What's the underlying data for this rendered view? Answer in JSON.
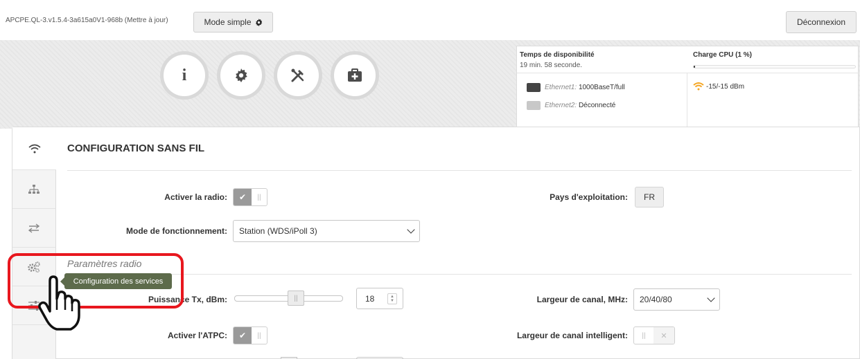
{
  "top_bar": {
    "version": "APCPE.QL-3.v1.5.4-3a615a0V1-968b (Mettre à jour)",
    "mode_button": "Mode simple",
    "logout_button": "Déconnexion"
  },
  "banner": {
    "circle_buttons": [
      {
        "icon": "info-icon",
        "glyph": "i"
      },
      {
        "icon": "gear-icon",
        "glyph": "⚙"
      },
      {
        "icon": "tools-icon",
        "glyph": "✂"
      },
      {
        "icon": "first-aid-icon",
        "glyph": "+"
      }
    ]
  },
  "status": {
    "uptime_label": "Temps de disponibilité",
    "uptime_value": "19 min. 58 seconde.",
    "cpu_label": "Charge CPU (1 %)",
    "cpu_percent": 1,
    "eth1_name": "Ethernet1:",
    "eth1_value": "1000BaseT/full",
    "eth2_name": "Ethernet2:",
    "eth2_value": "Déconnecté",
    "signal_value": "-15/-15 dBm"
  },
  "sidebar": {
    "tabs": [
      {
        "icon": "wifi-icon",
        "active": true
      },
      {
        "icon": "network-icon",
        "active": false
      },
      {
        "icon": "transfer-icon",
        "active": false
      },
      {
        "icon": "services-gear-icon",
        "active": false
      },
      {
        "icon": "sliders-icon",
        "active": false
      }
    ]
  },
  "main": {
    "section_title": "CONFIGURATION SANS FIL",
    "radio_enable_label": "Activer la radio:",
    "country_label": "Pays d'exploitation:",
    "country_value": "FR",
    "operation_mode_label": "Mode de fonctionnement:",
    "operation_mode_value": "Station (WDS/iPoll 3)",
    "radio_params_subtitle": "Paramètres radio",
    "tx_power_label": "Puissance Tx, dBm:",
    "tx_power_value": "18",
    "channel_width_label": "Largeur de canal, MHz:",
    "channel_width_value": "20/40/80",
    "atpc_label": "Activer l'ATPC:",
    "smart_width_label": "Largeur de canal intelligent:"
  },
  "tooltip": {
    "text": "Configuration des services"
  },
  "colors": {
    "highlight": "#e8171e",
    "tooltip_bg": "#5d6b4b",
    "toggle_on": "#9a9a9a",
    "signal": "#f5a623"
  }
}
